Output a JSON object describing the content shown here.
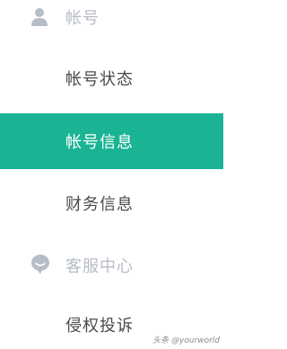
{
  "menu": {
    "groups": [
      {
        "icon": "user-icon",
        "label": "帐号",
        "items": [
          {
            "label": "帐号状态",
            "active": false
          },
          {
            "label": "帐号信息",
            "active": true
          },
          {
            "label": "财务信息",
            "active": false
          }
        ]
      },
      {
        "icon": "chat-bubble-icon",
        "label": "客服中心",
        "items": [
          {
            "label": "侵权投诉",
            "active": false
          }
        ]
      }
    ]
  },
  "watermark": "头条 @yourworld",
  "colors": {
    "active_bg": "#1ab394",
    "group_label": "#b7bdc6",
    "item_label": "#4a4a4a"
  }
}
